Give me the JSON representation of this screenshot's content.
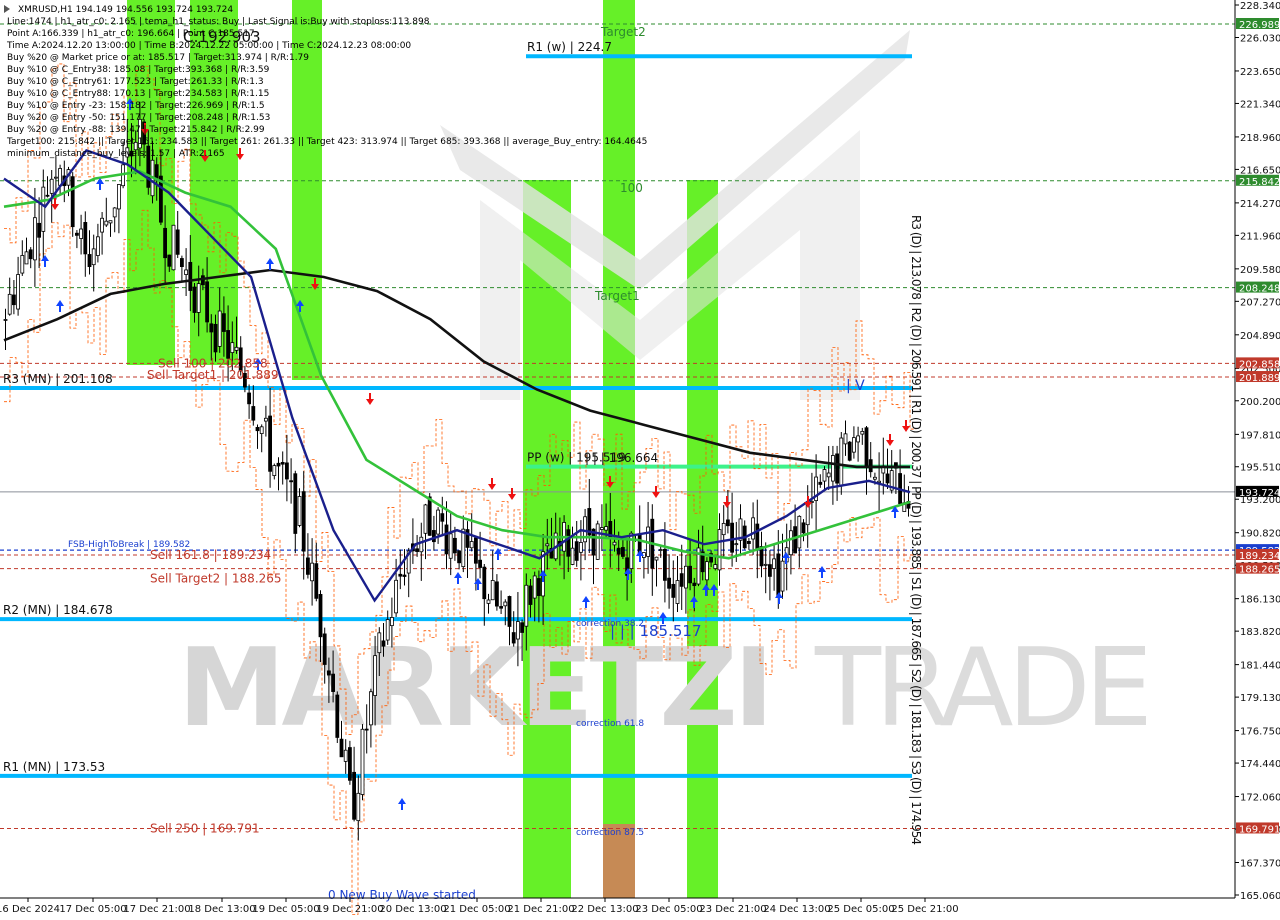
{
  "chart_data": {
    "type": "candlestick",
    "symbol_line": "XMRUSD,H1  194.149 194.556 193.724 193.724",
    "info_lines": [
      "Line:1474 | h1_atr_c0: 2.165 | tema_h1_status: Buy | Last Signal is:Buy with stoploss:113.898",
      "Point A:166.339 | h1_atr_c0: 196.664 | Point C:185.517",
      "Time A:2024.12.20 13:00:00 | Time B:2024.12.22 05:00:00 | Time C:2024.12.23 08:00:00",
      "Buy %20 @ Market price or at: 185.517 | Target:313.974 | R/R:1.79",
      "Buy %10 @ C_Entry38: 185.08 | Target:393.368 | R/R:3.59",
      "Buy %10 @ C_Entry61: 177.523 | Target:261.33 | R/R:1.3",
      "Buy %10 @ C_Entry88: 170.13 | Target:234.583 | R/R:1.15",
      "Buy %10 @ Entry -23: 158.182 | Target:226.969 | R/R:1.5",
      "Buy %20 @ Entry -50: 151.177 | Target:208.248 | R/R:1.53",
      "Buy %20 @ Entry -88: 139.47 | Target:215.842 | R/R:2.99",
      "Target100: 215.842 || Target 161: 234.583 || Target 261: 261.33 || Target 423: 313.974 || Target 685: 393.368 || average_Buy_entry: 164.4645",
      "minimum_distance_buy_levels: 1.57 | ATR:2.165"
    ],
    "y_axis": {
      "min": 165.06,
      "max": 228.34,
      "ticks": [
        "228.340",
        "226.030",
        "223.650",
        "221.340",
        "218.960",
        "216.650",
        "214.270",
        "211.960",
        "209.580",
        "207.270",
        "204.890",
        "202.500",
        "200.200",
        "197.810",
        "195.510",
        "193.200",
        "190.820",
        "188.510",
        "186.130",
        "183.820",
        "181.440",
        "179.130",
        "176.750",
        "174.440",
        "172.060",
        "169.750",
        "167.370",
        "165.060"
      ]
    },
    "x_axis": {
      "labels": [
        "16 Dec 2024",
        "17 Dec 05:00",
        "17 Dec 21:00",
        "18 Dec 13:00",
        "19 Dec 05:00",
        "19 Dec 21:00",
        "20 Dec 13:00",
        "21 Dec 05:00",
        "21 Dec 21:00",
        "22 Dec 13:00",
        "23 Dec 05:00",
        "23 Dec 21:00",
        "24 Dec 13:00",
        "25 Dec 05:00",
        "25 Dec 21:00"
      ]
    },
    "price_tags": [
      {
        "value": 226.989,
        "text": "226.989",
        "color": "#2e8b2e"
      },
      {
        "value": 215.842,
        "text": "215.842",
        "color": "#2e8b2e"
      },
      {
        "value": 208.248,
        "text": "208.248",
        "color": "#2e8b2e"
      },
      {
        "value": 202.858,
        "text": "202.858",
        "color": "#c0392b"
      },
      {
        "value": 201.889,
        "text": "201.889",
        "color": "#c0392b"
      },
      {
        "value": 193.724,
        "text": "193.724",
        "color": "#000000"
      },
      {
        "value": 189.582,
        "text": "189.582",
        "color": "#1a3fcf"
      },
      {
        "value": 189.234,
        "text": "189.234",
        "color": "#c0392b"
      },
      {
        "value": 188.265,
        "text": "188.265",
        "color": "#c0392b"
      },
      {
        "value": 169.791,
        "text": "169.791",
        "color": "#c0392b"
      }
    ],
    "levels": [
      {
        "text": "R3 (MN) | 201.108",
        "value": 201.108,
        "color": "#00b7ff"
      },
      {
        "text": "R2 (MN) | 184.678",
        "value": 184.678,
        "color": "#00b7ff"
      },
      {
        "text": "R1 (MN) | 173.53",
        "value": 173.53,
        "color": "#00b7ff"
      },
      {
        "text": "R1 (w) | 224.7",
        "value": 224.7,
        "color": "#00b7ff"
      },
      {
        "text": "PP (w) | 195.519",
        "value": 195.519,
        "color": "#3df28a"
      }
    ],
    "sell_labels": [
      {
        "text": "Sell 100 | 202.858",
        "value": 202.858
      },
      {
        "text": "Sell Target1 | 201.889",
        "value": 201.889
      },
      {
        "text": "Sell 161.8 | 189.234",
        "value": 189.234
      },
      {
        "text": "Sell Target2 | 188.265",
        "value": 188.265
      },
      {
        "text": "Sell  250 | 169.791",
        "value": 169.791
      }
    ],
    "other_labels": {
      "fsb": "FSB-HighToBreak | 189.582",
      "target2": "Target2",
      "target1": "Target1",
      "hundred": "100",
      "correction382": "correction 38.2",
      "correction618": "correction 61.8",
      "correction875": "correction 87.5",
      "point_c": "| | | 185.517",
      "point_b": "| | | 196.664",
      "top_label": "C:192.903",
      "new_wave": "0 New Buy Wave started",
      "iv": "| V",
      "watermark_left": "MARKETZI",
      "watermark_right": "TRADE"
    },
    "daily_pivots_vertical": "R3 (D) | 213.078 | R2 (D) | 206.591 | R1 (D) | 200.37 | PP (D) | 193.885 | S1 (D) | 187.665 | S2 (D) | 181.183 | S3 (D) | 174.954",
    "candles_close_trend": [
      206.5,
      212.0,
      218.0,
      210.0,
      214.0,
      219.5,
      212.0,
      208.5,
      205.0,
      202.0,
      196.0,
      192.0,
      183.0,
      171.0,
      182.0,
      189.0,
      192.0,
      190.0,
      187.0,
      183.5,
      188.0,
      190.0,
      191.0,
      189.0,
      190.5,
      187.5,
      189.0,
      190.0,
      191.5,
      188.0,
      192.0,
      195.0,
      198.0,
      194.5,
      193.7
    ],
    "ma_black": [
      204.5,
      206.0,
      207.8,
      208.5,
      209.0,
      209.5,
      209.0,
      208.0,
      206.0,
      203.0,
      201.0,
      199.5,
      198.5,
      197.5,
      196.5,
      196.0,
      195.5,
      195.5
    ],
    "ma_green": [
      214.0,
      214.5,
      216.0,
      216.5,
      215.0,
      214.0,
      211.0,
      202.0,
      196.0,
      194.0,
      192.0,
      191.0,
      190.5,
      190.5,
      190.3,
      189.5,
      189.0,
      190.0,
      191.0,
      192.0,
      193.0
    ],
    "ma_navy": [
      216.0,
      214.0,
      218.0,
      217.0,
      215.0,
      212.0,
      209.0,
      199.0,
      191.0,
      186.0,
      190.0,
      191.0,
      190.0,
      189.0,
      191.0,
      190.5,
      191.0,
      190.0,
      190.5,
      192.0,
      194.0,
      194.5,
      193.7
    ]
  }
}
